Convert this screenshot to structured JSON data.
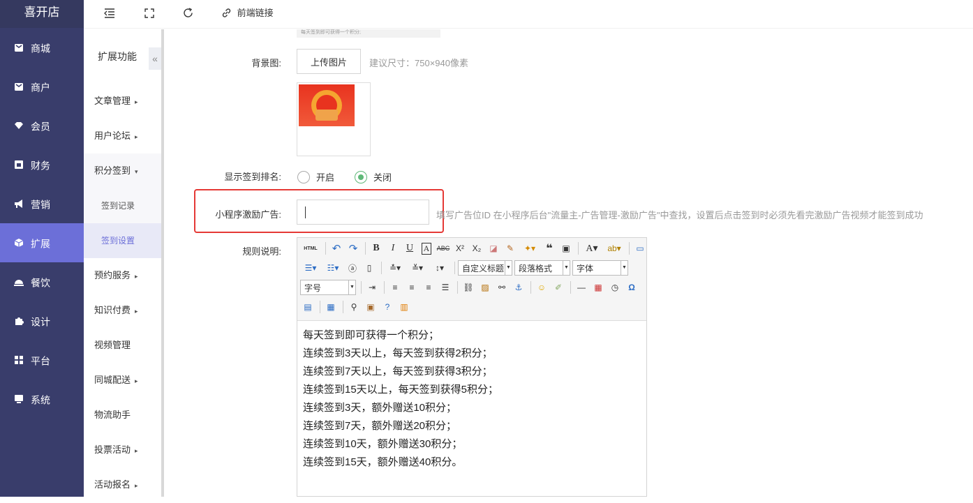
{
  "app": {
    "brand": "喜开店"
  },
  "sidebar": {
    "items": [
      {
        "label": "商城",
        "icon": "shop-icon"
      },
      {
        "label": "商户",
        "icon": "merchant-icon"
      },
      {
        "label": "会员",
        "icon": "member-icon"
      },
      {
        "label": "财务",
        "icon": "finance-icon"
      },
      {
        "label": "营销",
        "icon": "marketing-icon"
      },
      {
        "label": "扩展",
        "icon": "extension-icon",
        "active": true
      },
      {
        "label": "餐饮",
        "icon": "dining-icon"
      },
      {
        "label": "设计",
        "icon": "design-icon"
      },
      {
        "label": "平台",
        "icon": "platform-icon"
      },
      {
        "label": "系统",
        "icon": "system-icon"
      }
    ]
  },
  "subnav": {
    "title": "扩展功能",
    "collapse": "«",
    "items": [
      {
        "label": "文章管理",
        "caret": "▸"
      },
      {
        "label": "用户论坛",
        "caret": "▸"
      },
      {
        "label": "积分签到",
        "caret": "▾"
      },
      {
        "label": "签到记录"
      },
      {
        "label": "签到设置"
      },
      {
        "label": "预约服务",
        "caret": "▸"
      },
      {
        "label": "知识付费",
        "caret": "▸"
      },
      {
        "label": "视频管理"
      },
      {
        "label": "同城配送",
        "caret": "▸"
      },
      {
        "label": "物流助手"
      },
      {
        "label": "投票活动",
        "caret": "▸"
      },
      {
        "label": "活动报名",
        "caret": "▸"
      }
    ]
  },
  "topbar": {
    "frontend_link": "前端链接"
  },
  "form": {
    "top_thumb_text": "每天签到即可获得一个积分;",
    "bg_label": "背景图:",
    "upload_button": "上传图片",
    "size_tip": "建议尺寸：750×940像素",
    "rank_label": "显示签到排名:",
    "rank_on": "开启",
    "rank_off": "关闭",
    "ad_label": "小程序激励广告:",
    "ad_value": "",
    "ad_tip": "填写广告位ID 在小程序后台\"流量主-广告管理-激励广告\"中查找，设置后点击签到时必须先看完激励广告视频才能签到成功",
    "rules_label": "规则说明:"
  },
  "editor": {
    "combo_title": "自定义标题",
    "combo_para": "段落格式",
    "combo_font": "字体",
    "combo_size": "字号",
    "lines": [
      "每天签到即可获得一个积分；",
      "连续签到3天以上，每天签到获得2积分；",
      "连续签到7天以上，每天签到获得3积分；",
      "连续签到15天以上，每天签到获得5积分；",
      "连续签到3天，额外赠送10积分；",
      "连续签到7天，额外赠送20积分；",
      "连续签到10天，额外赠送30积分；",
      "连续签到15天，额外赠送40积分。"
    ]
  },
  "colors": {
    "sidebar_bg": "#393d6b",
    "accent": "#6c6fd8",
    "highlight": "#e53935",
    "radio_checked": "#5fb878"
  }
}
